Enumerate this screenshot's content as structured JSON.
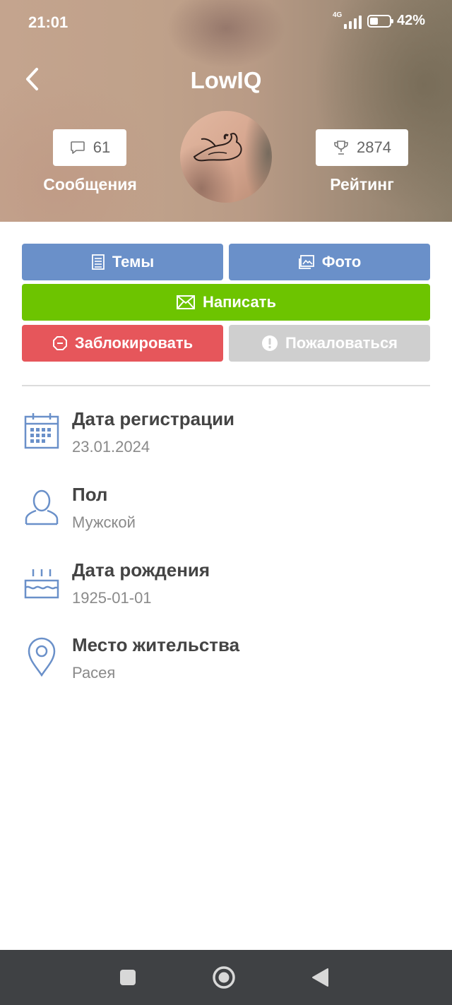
{
  "statusbar": {
    "time": "21:01",
    "network": "4G",
    "battery_percent": "42%",
    "battery_level": 0.42
  },
  "header": {
    "title": "LowIQ",
    "messages_count": "61",
    "messages_label": "Сообщения",
    "rating_value": "2874",
    "rating_label": "Рейтинг"
  },
  "actions": {
    "topics": "Темы",
    "photo": "Фото",
    "write": "Написать",
    "block": "Заблокировать",
    "report": "Пожаловаться"
  },
  "colors": {
    "primary": "#6a90c9",
    "write": "#6dc400",
    "block": "#e6565b",
    "report": "#cfcfcf",
    "icon": "#6a90c9"
  },
  "info": [
    {
      "icon": "calendar-icon",
      "title": "Дата регистрации",
      "value": "23.01.2024"
    },
    {
      "icon": "user-icon",
      "title": "Пол",
      "value": "Мужской"
    },
    {
      "icon": "cake-icon",
      "title": "Дата рождения",
      "value": "1925-01-01"
    },
    {
      "icon": "location-pin-icon",
      "title": "Место жительства",
      "value": "Расея"
    }
  ]
}
